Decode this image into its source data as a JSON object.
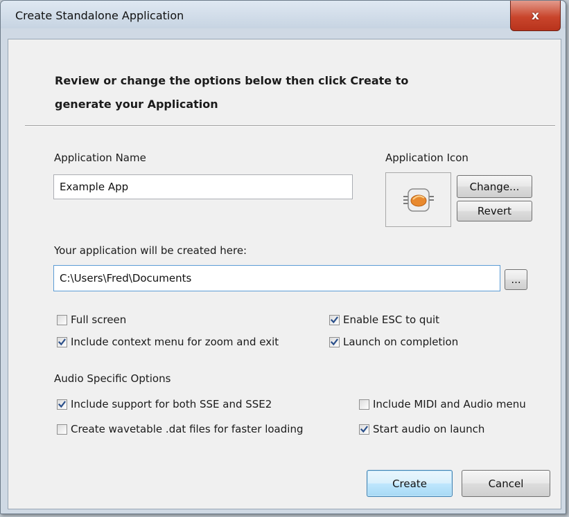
{
  "window": {
    "title": "Create Standalone Application",
    "close_glyph": "x"
  },
  "heading": {
    "line1": "Review or change the options below then click Create to",
    "line2": "generate your Application"
  },
  "app_name": {
    "label": "Application Name",
    "value": "Example App"
  },
  "app_icon": {
    "label": "Application Icon",
    "icon": "app-icon",
    "change_label": "Change...",
    "revert_label": "Revert"
  },
  "location": {
    "label": "Your application will be created here:",
    "value": "C:\\Users\\Fred\\Documents",
    "browse_label": "..."
  },
  "options": [
    {
      "label": "Full screen",
      "checked": false
    },
    {
      "label": "Enable ESC to quit",
      "checked": true
    },
    {
      "label": "Include context menu for zoom and exit",
      "checked": true
    },
    {
      "label": "Launch on completion",
      "checked": true
    }
  ],
  "audio": {
    "label": "Audio Specific Options",
    "options": [
      {
        "label": "Include support for both SSE and SSE2",
        "checked": true
      },
      {
        "label": "Include MIDI and Audio menu",
        "checked": false
      },
      {
        "label": "Create wavetable .dat files for faster loading",
        "checked": false
      },
      {
        "label": "Start audio on launch",
        "checked": true
      }
    ]
  },
  "buttons": {
    "create_label": "Create",
    "cancel_label": "Cancel"
  },
  "colors": {
    "accent": "#3c7fb1",
    "close": "#c9452c",
    "check": "#2a4f8a"
  }
}
